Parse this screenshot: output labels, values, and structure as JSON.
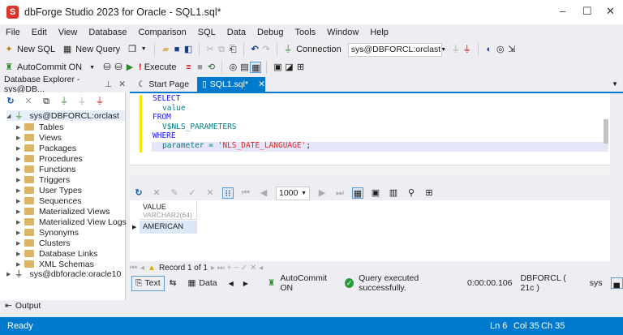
{
  "window": {
    "title": "dbForge Studio 2023 for Oracle - SQL1.sql*",
    "logo": "S",
    "minimize": "–",
    "maximize": "☐",
    "close": "✕"
  },
  "menu": [
    "File",
    "Edit",
    "View",
    "Database",
    "Comparison",
    "SQL",
    "Data",
    "Debug",
    "Tools",
    "Window",
    "Help"
  ],
  "toolbar1": {
    "new_sql": "New SQL",
    "new_query": "New Query",
    "connection_label": "Connection",
    "connection_value": "sys@DBFORCL:orclast"
  },
  "toolbar2": {
    "autocommit": "AutoCommit ON",
    "execute": "Execute"
  },
  "explorer": {
    "title": "Database Explorer - sys@DB...",
    "connection": "sys@DBFORCL:orclast",
    "folders": [
      "Tables",
      "Views",
      "Packages",
      "Procedures",
      "Functions",
      "Triggers",
      "User Types",
      "Sequences",
      "Materialized Views",
      "Materialized View Logs",
      "Synonyms",
      "Clusters",
      "Database Links",
      "XML Schemas"
    ],
    "connection2": "sys@dbforacle:oracle10"
  },
  "tabs": {
    "start": "Start Page",
    "sql": "SQL1.sql*"
  },
  "code": {
    "l1": "SELECT",
    "l2": "value",
    "l3": "FROM",
    "l4": "V$NLS_PARAMETERS",
    "l5": "WHERE",
    "l6a": "parameter = ",
    "l6b": "'NLS_DATE_LANGUAGE'",
    "l6c": ";"
  },
  "results": {
    "page_size": "1000",
    "column": "VALUE",
    "column_type": "VARCHAR2(64)",
    "rows": [
      "AMERICAN"
    ],
    "record": "Record 1 of 1"
  },
  "bottom": {
    "text": "Text",
    "data": "Data",
    "autocommit": "AutoCommit ON",
    "message": "Query executed successfully.",
    "time": "0:00:00.106",
    "server": "DBFORCL ( 21c )",
    "user": "sys"
  },
  "output": "Output",
  "status": {
    "ready": "Ready",
    "ln": "Ln 6",
    "col": "Col 35",
    "ch": "Ch 35"
  },
  "colors": {
    "accent": "#007acc",
    "keyword": "#1a1aff",
    "identifier": "#008080",
    "string": "#e3261b"
  }
}
